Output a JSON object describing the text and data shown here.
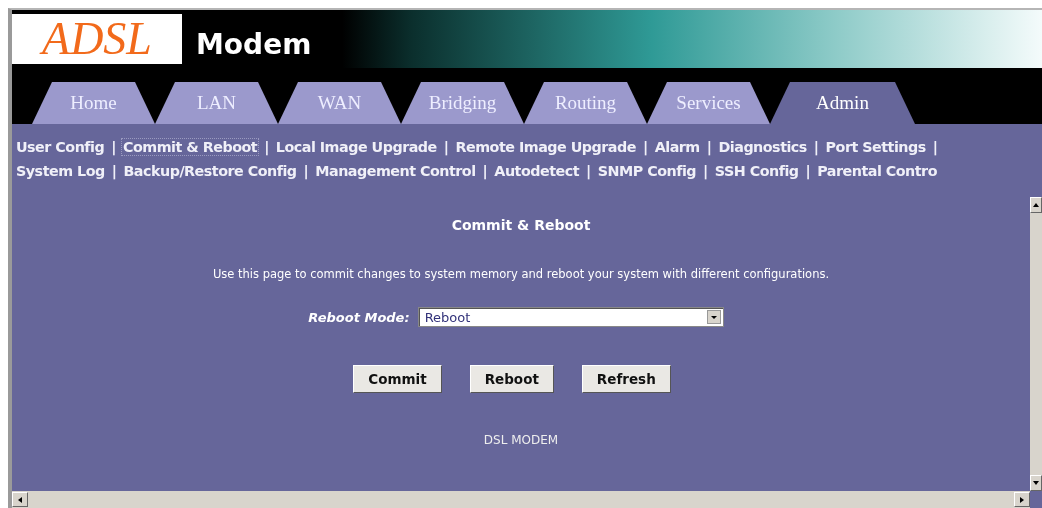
{
  "header": {
    "logo": "ADSL",
    "title": "Modem"
  },
  "tabs": [
    {
      "label": "Home",
      "selected": false
    },
    {
      "label": "LAN",
      "selected": false
    },
    {
      "label": "WAN",
      "selected": false
    },
    {
      "label": "Bridging",
      "selected": false
    },
    {
      "label": "Routing",
      "selected": false
    },
    {
      "label": "Services",
      "selected": false
    },
    {
      "label": "Admin",
      "selected": true
    }
  ],
  "sub_nav": [
    [
      {
        "kind": "link",
        "label": "User Config",
        "selected": false
      },
      {
        "kind": "separator",
        "label": "|"
      },
      {
        "kind": "link",
        "label": "Commit & Reboot",
        "selected": true
      },
      {
        "kind": "separator",
        "label": "|"
      },
      {
        "kind": "link",
        "label": "Local Image Upgrade",
        "selected": false
      },
      {
        "kind": "separator",
        "label": "|"
      },
      {
        "kind": "link",
        "label": "Remote Image Upgrade",
        "selected": false
      },
      {
        "kind": "separator",
        "label": "|"
      },
      {
        "kind": "link",
        "label": "Alarm",
        "selected": false
      },
      {
        "kind": "separator",
        "label": "|"
      },
      {
        "kind": "link",
        "label": "Diagnostics",
        "selected": false
      },
      {
        "kind": "separator",
        "label": "|"
      },
      {
        "kind": "link",
        "label": "Port Settings",
        "selected": false
      },
      {
        "kind": "separator",
        "label": "|"
      }
    ],
    [
      {
        "kind": "link",
        "label": "System Log",
        "selected": false
      },
      {
        "kind": "separator",
        "label": "|"
      },
      {
        "kind": "link",
        "label": "Backup/Restore Config",
        "selected": false
      },
      {
        "kind": "separator",
        "label": "|"
      },
      {
        "kind": "link",
        "label": "Management Control",
        "selected": false
      },
      {
        "kind": "separator",
        "label": "|"
      },
      {
        "kind": "link",
        "label": "Autodetect",
        "selected": false
      },
      {
        "kind": "separator",
        "label": "|"
      },
      {
        "kind": "link",
        "label": "SNMP Config",
        "selected": false
      },
      {
        "kind": "separator",
        "label": "|"
      },
      {
        "kind": "link",
        "label": "SSH Config",
        "selected": false
      },
      {
        "kind": "separator",
        "label": "|"
      },
      {
        "kind": "link",
        "label": "Parental Contro",
        "selected": false
      }
    ]
  ],
  "page": {
    "title": "Commit & Reboot",
    "description": "Use this page to commit changes to system memory and reboot your system with different configurations.",
    "field": {
      "label": "Reboot Mode:",
      "value": "Reboot"
    },
    "buttons": [
      "Commit",
      "Reboot",
      "Refresh"
    ],
    "footer": "DSL MODEM"
  }
}
